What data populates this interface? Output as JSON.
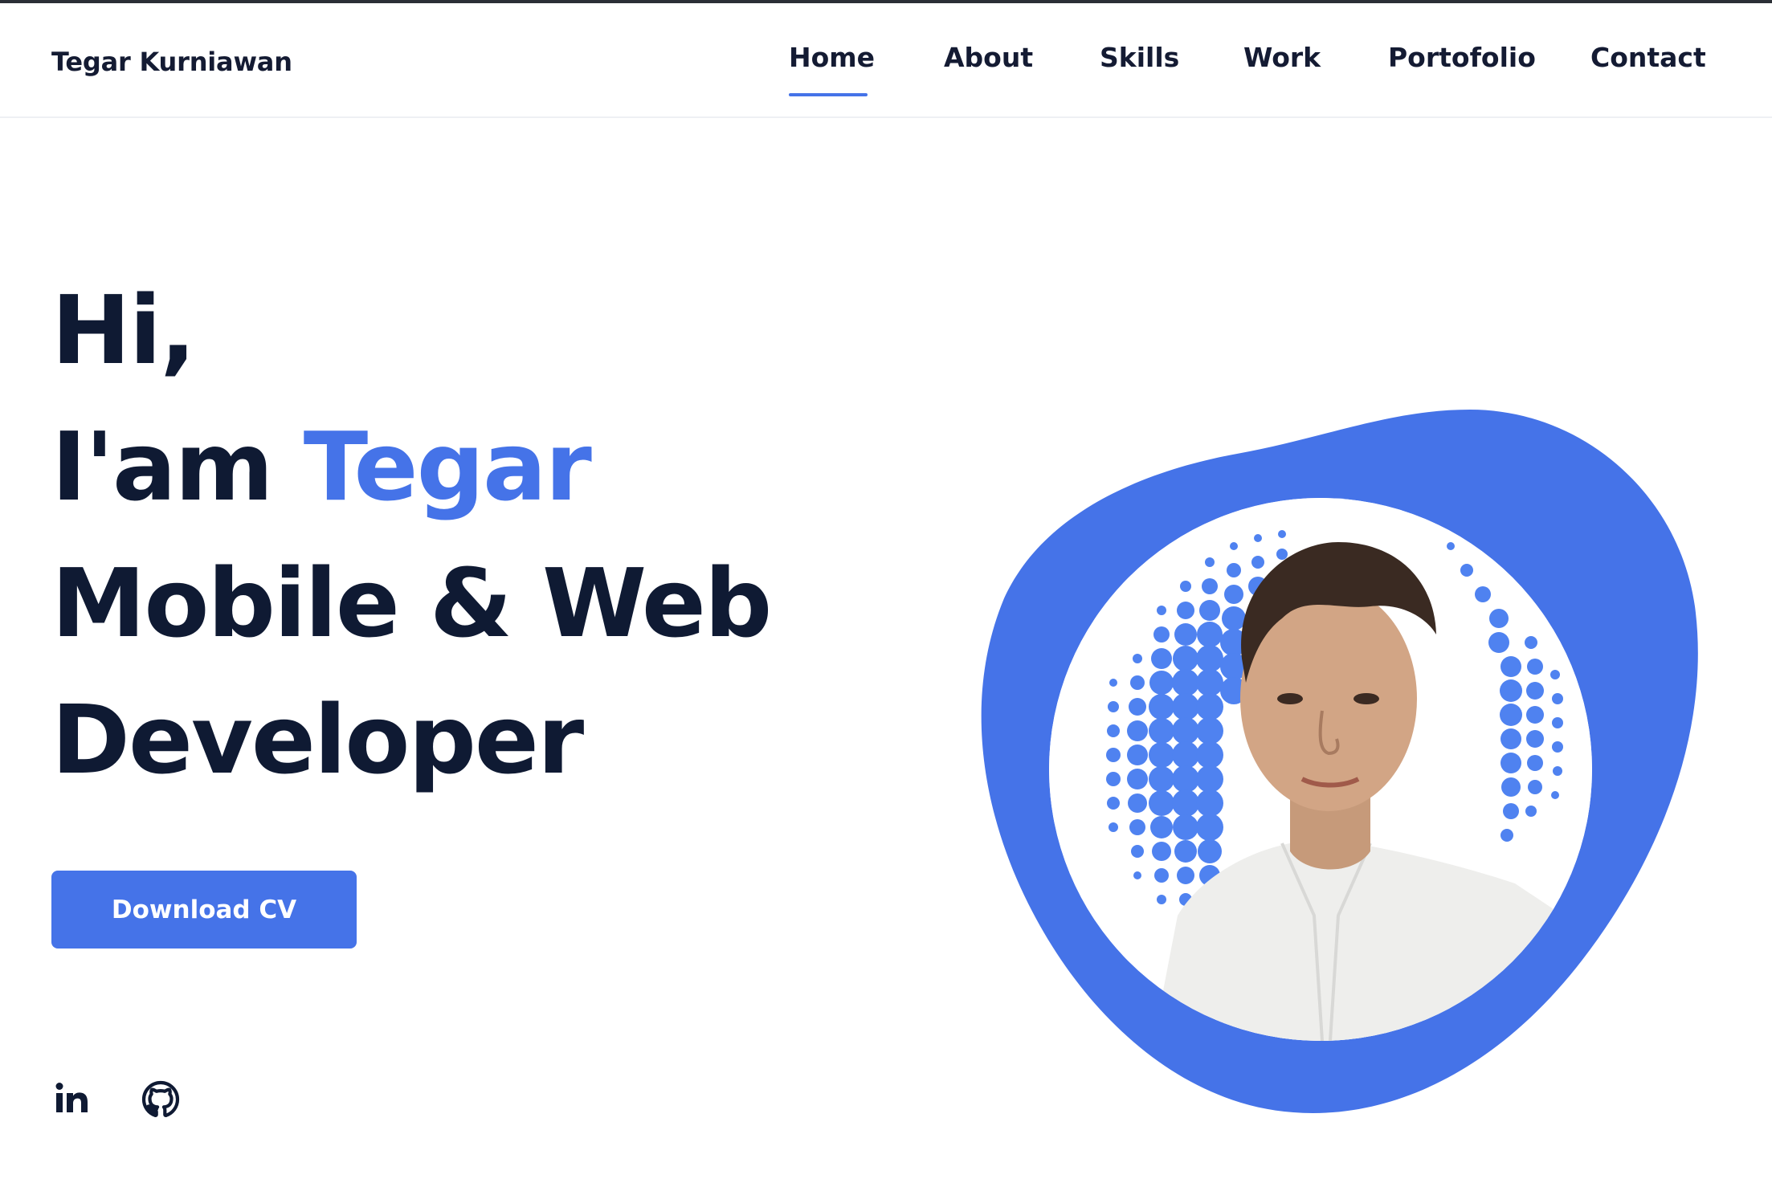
{
  "header": {
    "brand": "Tegar Kurniawan",
    "nav": {
      "home": "Home",
      "about": "About",
      "skills": "Skills",
      "work": "Work",
      "portfolio": "Portofolio",
      "contact": "Contact"
    },
    "active_item": "Home"
  },
  "hero": {
    "greeting": "Hi,",
    "intro_prefix": "I'am",
    "name": "Tegar",
    "role_line1": "Mobile & Web",
    "role_line2": "Developer",
    "cta_label": "Download CV"
  },
  "social": {
    "icons": [
      "linkedin-icon",
      "github-icon"
    ]
  },
  "colors": {
    "accent": "#4573e8",
    "text": "#0f1a33",
    "background": "#ffffff"
  }
}
